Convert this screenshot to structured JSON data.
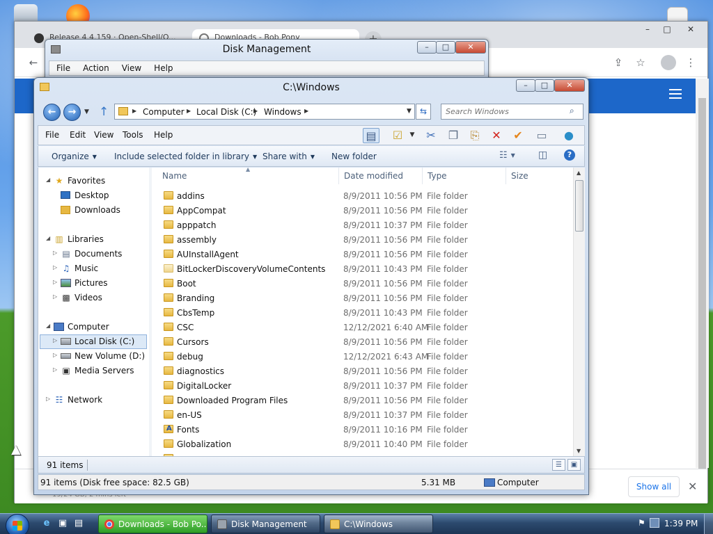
{
  "chrome": {
    "tabs": [
      {
        "label": "Release 4.4.159 · Open-Shell/O..."
      },
      {
        "label": "Downloads - Bob Pony"
      }
    ],
    "new_tab": "+",
    "show_all": "Show all",
    "download_subtext": "19/24 GB, 2 mins left"
  },
  "disk_management": {
    "title": "Disk Management",
    "menu": [
      "File",
      "Action",
      "View",
      "Help"
    ]
  },
  "explorer": {
    "title": "C:\\Windows",
    "breadcrumb": [
      "Computer",
      "Local Disk (C:)",
      "Windows"
    ],
    "search_placeholder": "Search Windows",
    "menu": [
      "File",
      "Edit",
      "View",
      "Tools",
      "Help"
    ],
    "commands": {
      "organize": "Organize",
      "include": "Include selected folder in library",
      "share": "Share with",
      "new_folder": "New folder"
    },
    "nav": {
      "favorites": "Favorites",
      "desktop": "Desktop",
      "downloads": "Downloads",
      "libraries": "Libraries",
      "documents": "Documents",
      "music": "Music",
      "pictures": "Pictures",
      "videos": "Videos",
      "computer": "Computer",
      "local_disk": "Local Disk (C:)",
      "new_volume": "New Volume (D:)",
      "media_servers": "Media Servers",
      "network": "Network"
    },
    "columns": {
      "name": "Name",
      "date": "Date modified",
      "type": "Type",
      "size": "Size"
    },
    "files": [
      {
        "name": "addins",
        "date": "8/9/2011 10:56 PM",
        "type": "File folder"
      },
      {
        "name": "AppCompat",
        "date": "8/9/2011 10:56 PM",
        "type": "File folder"
      },
      {
        "name": "apppatch",
        "date": "8/9/2011 10:37 PM",
        "type": "File folder"
      },
      {
        "name": "assembly",
        "date": "8/9/2011 10:56 PM",
        "type": "File folder"
      },
      {
        "name": "AUInstallAgent",
        "date": "8/9/2011 10:56 PM",
        "type": "File folder"
      },
      {
        "name": "BitLockerDiscoveryVolumeContents",
        "date": "8/9/2011 10:43 PM",
        "type": "File folder"
      },
      {
        "name": "Boot",
        "date": "8/9/2011 10:56 PM",
        "type": "File folder"
      },
      {
        "name": "Branding",
        "date": "8/9/2011 10:56 PM",
        "type": "File folder"
      },
      {
        "name": "CbsTemp",
        "date": "8/9/2011 10:43 PM",
        "type": "File folder"
      },
      {
        "name": "CSC",
        "date": "12/12/2021 6:40 AM",
        "type": "File folder"
      },
      {
        "name": "Cursors",
        "date": "8/9/2011 10:56 PM",
        "type": "File folder"
      },
      {
        "name": "debug",
        "date": "12/12/2021 6:43 AM",
        "type": "File folder"
      },
      {
        "name": "diagnostics",
        "date": "8/9/2011 10:56 PM",
        "type": "File folder"
      },
      {
        "name": "DigitalLocker",
        "date": "8/9/2011 10:37 PM",
        "type": "File folder"
      },
      {
        "name": "Downloaded Program Files",
        "date": "8/9/2011 10:56 PM",
        "type": "File folder"
      },
      {
        "name": "en-US",
        "date": "8/9/2011 10:37 PM",
        "type": "File folder"
      },
      {
        "name": "Fonts",
        "date": "8/9/2011 10:16 PM",
        "type": "File folder"
      },
      {
        "name": "Globalization",
        "date": "8/9/2011 10:40 PM",
        "type": "File folder"
      }
    ],
    "item_count": "91 items",
    "status_left": "91 items (Disk free space: 82.5 GB)",
    "status_size": "5.31 MB",
    "status_location": "Computer"
  },
  "taskbar": {
    "buttons": [
      {
        "label": "Downloads - Bob Po..."
      },
      {
        "label": "Disk Management"
      },
      {
        "label": "C:\\Windows"
      }
    ],
    "clock": "1:39 PM"
  },
  "colors": {
    "accent_blue": "#1d67c9",
    "folder_yellow": "#e7b842",
    "taskbar_active": "#2e9d26"
  }
}
